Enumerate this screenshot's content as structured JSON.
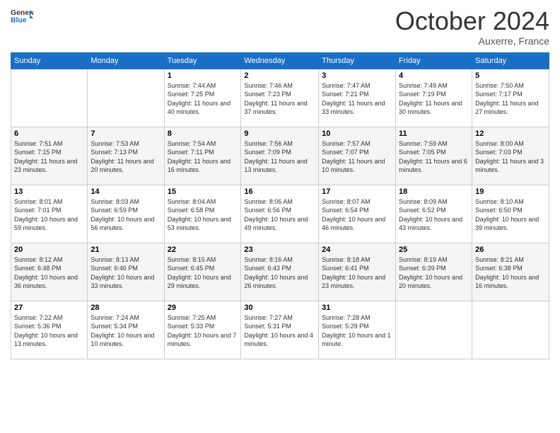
{
  "logo": {
    "line1": "General",
    "line2": "Blue"
  },
  "title": "October 2024",
  "location": "Auxerre, France",
  "days_of_week": [
    "Sunday",
    "Monday",
    "Tuesday",
    "Wednesday",
    "Thursday",
    "Friday",
    "Saturday"
  ],
  "weeks": [
    [
      {
        "day": "",
        "sunrise": "",
        "sunset": "",
        "daylight": ""
      },
      {
        "day": "",
        "sunrise": "",
        "sunset": "",
        "daylight": ""
      },
      {
        "day": "1",
        "sunrise": "Sunrise: 7:44 AM",
        "sunset": "Sunset: 7:25 PM",
        "daylight": "Daylight: 11 hours and 40 minutes."
      },
      {
        "day": "2",
        "sunrise": "Sunrise: 7:46 AM",
        "sunset": "Sunset: 7:23 PM",
        "daylight": "Daylight: 11 hours and 37 minutes."
      },
      {
        "day": "3",
        "sunrise": "Sunrise: 7:47 AM",
        "sunset": "Sunset: 7:21 PM",
        "daylight": "Daylight: 11 hours and 33 minutes."
      },
      {
        "day": "4",
        "sunrise": "Sunrise: 7:49 AM",
        "sunset": "Sunset: 7:19 PM",
        "daylight": "Daylight: 11 hours and 30 minutes."
      },
      {
        "day": "5",
        "sunrise": "Sunrise: 7:50 AM",
        "sunset": "Sunset: 7:17 PM",
        "daylight": "Daylight: 11 hours and 27 minutes."
      }
    ],
    [
      {
        "day": "6",
        "sunrise": "Sunrise: 7:51 AM",
        "sunset": "Sunset: 7:15 PM",
        "daylight": "Daylight: 11 hours and 23 minutes."
      },
      {
        "day": "7",
        "sunrise": "Sunrise: 7:53 AM",
        "sunset": "Sunset: 7:13 PM",
        "daylight": "Daylight: 11 hours and 20 minutes."
      },
      {
        "day": "8",
        "sunrise": "Sunrise: 7:54 AM",
        "sunset": "Sunset: 7:11 PM",
        "daylight": "Daylight: 11 hours and 16 minutes."
      },
      {
        "day": "9",
        "sunrise": "Sunrise: 7:56 AM",
        "sunset": "Sunset: 7:09 PM",
        "daylight": "Daylight: 11 hours and 13 minutes."
      },
      {
        "day": "10",
        "sunrise": "Sunrise: 7:57 AM",
        "sunset": "Sunset: 7:07 PM",
        "daylight": "Daylight: 11 hours and 10 minutes."
      },
      {
        "day": "11",
        "sunrise": "Sunrise: 7:59 AM",
        "sunset": "Sunset: 7:05 PM",
        "daylight": "Daylight: 11 hours and 6 minutes."
      },
      {
        "day": "12",
        "sunrise": "Sunrise: 8:00 AM",
        "sunset": "Sunset: 7:03 PM",
        "daylight": "Daylight: 11 hours and 3 minutes."
      }
    ],
    [
      {
        "day": "13",
        "sunrise": "Sunrise: 8:01 AM",
        "sunset": "Sunset: 7:01 PM",
        "daylight": "Daylight: 10 hours and 59 minutes."
      },
      {
        "day": "14",
        "sunrise": "Sunrise: 8:03 AM",
        "sunset": "Sunset: 6:59 PM",
        "daylight": "Daylight: 10 hours and 56 minutes."
      },
      {
        "day": "15",
        "sunrise": "Sunrise: 8:04 AM",
        "sunset": "Sunset: 6:58 PM",
        "daylight": "Daylight: 10 hours and 53 minutes."
      },
      {
        "day": "16",
        "sunrise": "Sunrise: 8:06 AM",
        "sunset": "Sunset: 6:56 PM",
        "daylight": "Daylight: 10 hours and 49 minutes."
      },
      {
        "day": "17",
        "sunrise": "Sunrise: 8:07 AM",
        "sunset": "Sunset: 6:54 PM",
        "daylight": "Daylight: 10 hours and 46 minutes."
      },
      {
        "day": "18",
        "sunrise": "Sunrise: 8:09 AM",
        "sunset": "Sunset: 6:52 PM",
        "daylight": "Daylight: 10 hours and 43 minutes."
      },
      {
        "day": "19",
        "sunrise": "Sunrise: 8:10 AM",
        "sunset": "Sunset: 6:50 PM",
        "daylight": "Daylight: 10 hours and 39 minutes."
      }
    ],
    [
      {
        "day": "20",
        "sunrise": "Sunrise: 8:12 AM",
        "sunset": "Sunset: 6:48 PM",
        "daylight": "Daylight: 10 hours and 36 minutes."
      },
      {
        "day": "21",
        "sunrise": "Sunrise: 8:13 AM",
        "sunset": "Sunset: 6:46 PM",
        "daylight": "Daylight: 10 hours and 33 minutes."
      },
      {
        "day": "22",
        "sunrise": "Sunrise: 8:15 AM",
        "sunset": "Sunset: 6:45 PM",
        "daylight": "Daylight: 10 hours and 29 minutes."
      },
      {
        "day": "23",
        "sunrise": "Sunrise: 8:16 AM",
        "sunset": "Sunset: 6:43 PM",
        "daylight": "Daylight: 10 hours and 26 minutes."
      },
      {
        "day": "24",
        "sunrise": "Sunrise: 8:18 AM",
        "sunset": "Sunset: 6:41 PM",
        "daylight": "Daylight: 10 hours and 23 minutes."
      },
      {
        "day": "25",
        "sunrise": "Sunrise: 8:19 AM",
        "sunset": "Sunset: 6:39 PM",
        "daylight": "Daylight: 10 hours and 20 minutes."
      },
      {
        "day": "26",
        "sunrise": "Sunrise: 8:21 AM",
        "sunset": "Sunset: 6:38 PM",
        "daylight": "Daylight: 10 hours and 16 minutes."
      }
    ],
    [
      {
        "day": "27",
        "sunrise": "Sunrise: 7:22 AM",
        "sunset": "Sunset: 5:36 PM",
        "daylight": "Daylight: 10 hours and 13 minutes."
      },
      {
        "day": "28",
        "sunrise": "Sunrise: 7:24 AM",
        "sunset": "Sunset: 5:34 PM",
        "daylight": "Daylight: 10 hours and 10 minutes."
      },
      {
        "day": "29",
        "sunrise": "Sunrise: 7:25 AM",
        "sunset": "Sunset: 5:33 PM",
        "daylight": "Daylight: 10 hours and 7 minutes."
      },
      {
        "day": "30",
        "sunrise": "Sunrise: 7:27 AM",
        "sunset": "Sunset: 5:31 PM",
        "daylight": "Daylight: 10 hours and 4 minutes."
      },
      {
        "day": "31",
        "sunrise": "Sunrise: 7:28 AM",
        "sunset": "Sunset: 5:29 PM",
        "daylight": "Daylight: 10 hours and 1 minute."
      },
      {
        "day": "",
        "sunrise": "",
        "sunset": "",
        "daylight": ""
      },
      {
        "day": "",
        "sunrise": "",
        "sunset": "",
        "daylight": ""
      }
    ]
  ]
}
